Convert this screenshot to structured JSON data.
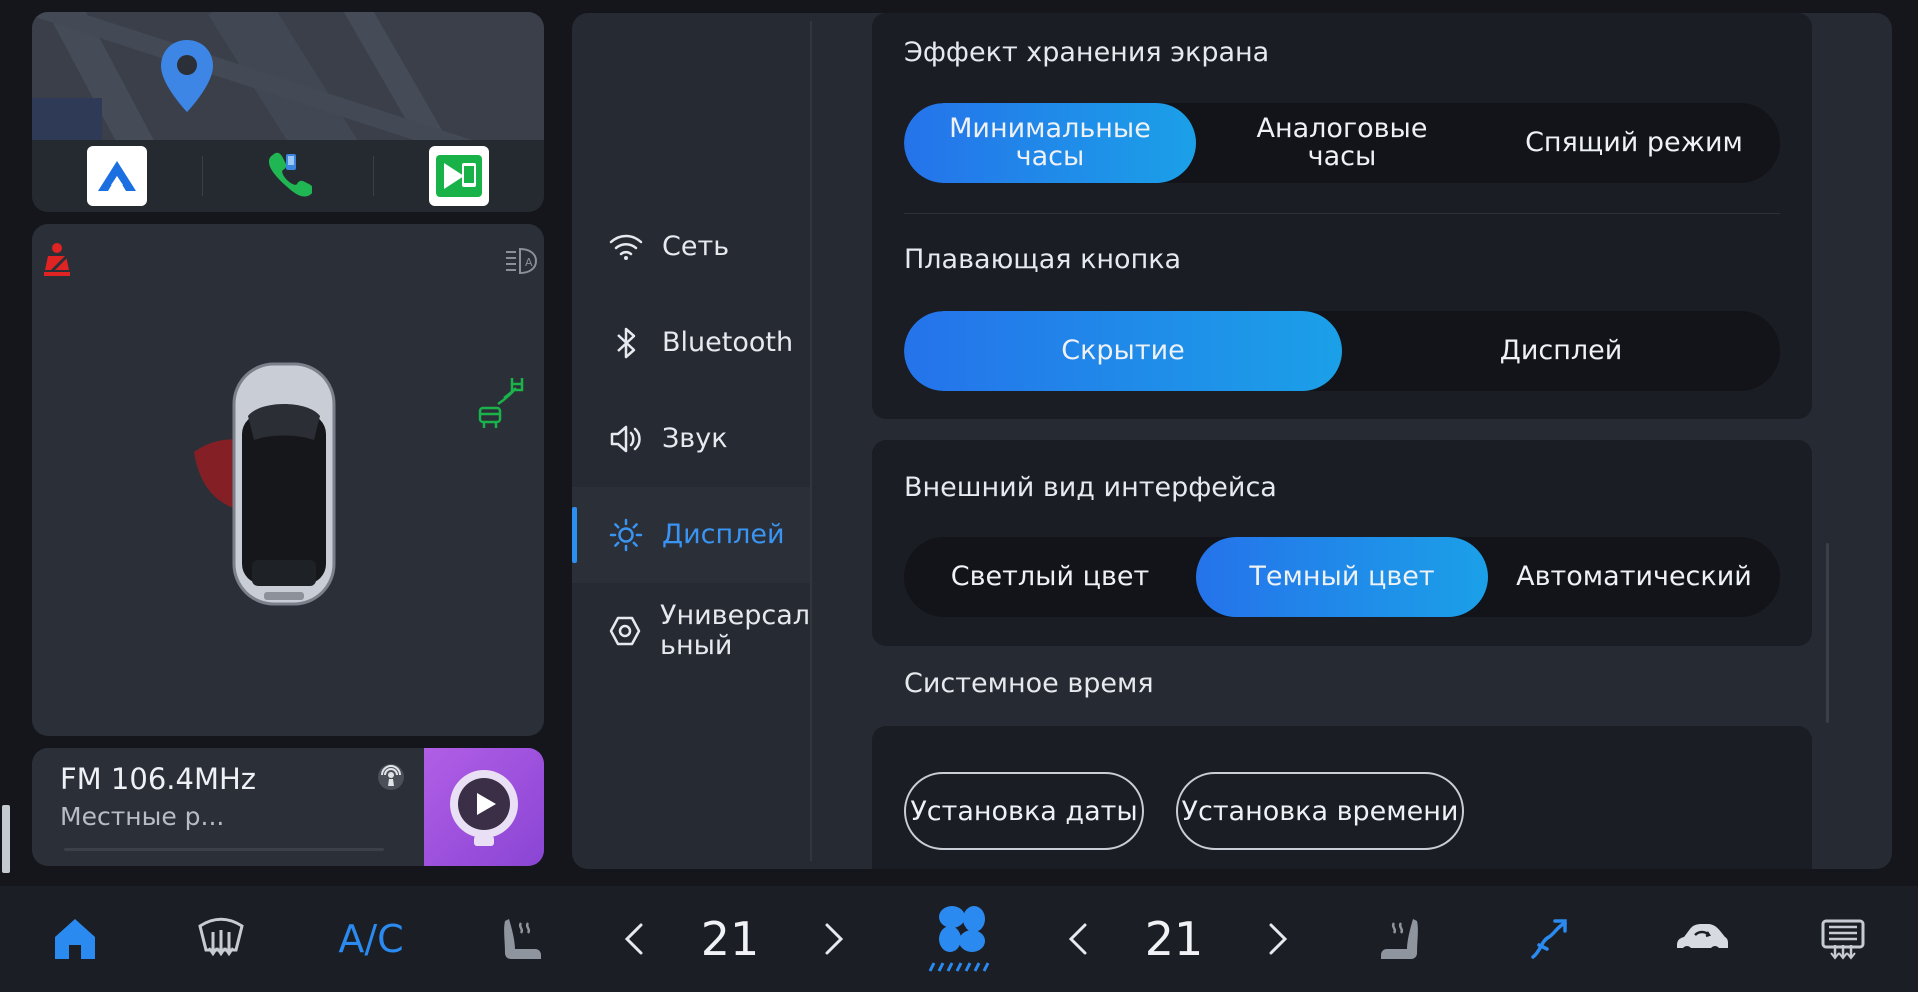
{
  "colors": {
    "accent": "#2c8ff0",
    "selected_gradient_start": "#2573ea",
    "selected_gradient_end": "#1ba0e8",
    "alert_red": "#e02424",
    "indicator_green": "#19b34a",
    "panel": "#262a32"
  },
  "map_widget": {
    "apps": [
      {
        "name": "navigation-app-icon"
      },
      {
        "name": "phone-icon"
      },
      {
        "name": "media-cast-app-icon"
      }
    ]
  },
  "vehicle": {
    "icons": [
      "seatbelt-warning-icon",
      "auto-headlight-icon",
      "lane-assist-icon"
    ],
    "door_open": "front-left"
  },
  "radio": {
    "station": "FM 106.4MHz",
    "subtitle": "Местные р..."
  },
  "nav": {
    "items": [
      {
        "label": "Сеть",
        "icon": "wifi-icon"
      },
      {
        "label": "Bluetooth",
        "icon": "bluetooth-icon"
      },
      {
        "label": "Звук",
        "icon": "speaker-icon"
      },
      {
        "label": "Дисплей",
        "icon": "brightness-icon",
        "active": true
      },
      {
        "label": "Универсал ьный",
        "line1": "Универсал",
        "line2": "ьный",
        "icon": "general-settings-icon"
      }
    ]
  },
  "settings": {
    "screensaver": {
      "title": "Эффект хранения экрана",
      "options": [
        {
          "l1": "Минимальные",
          "l2": "часы"
        },
        {
          "l1": "Аналоговые",
          "l2": "часы"
        },
        {
          "l1": "Спящий режим",
          "l2": ""
        }
      ],
      "selected": 0
    },
    "floating_button": {
      "title": "Плавающая кнопка",
      "options": [
        "Скрытие",
        "Дисплей"
      ],
      "selected": 0
    },
    "appearance": {
      "title": "Внешний вид интерфейса",
      "options": [
        "Светлый цвет",
        "Темный цвет",
        "Автоматический"
      ],
      "selected": 1
    },
    "system_time": {
      "title": "Системное время",
      "set_date": "Установка даты",
      "set_time": "Установка времени"
    }
  },
  "bottom_bar": {
    "ac_label": "A/C",
    "left_temp": "21",
    "right_temp": "21"
  }
}
